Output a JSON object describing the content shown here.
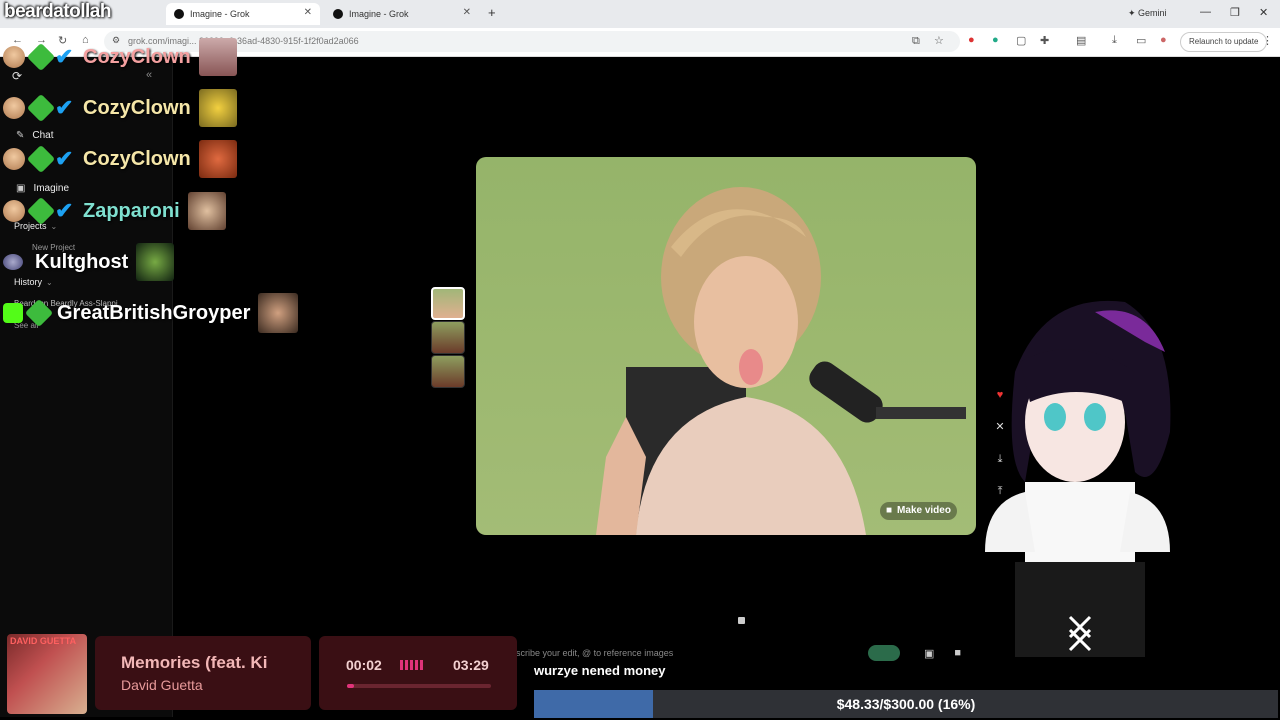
{
  "browser": {
    "tabs": [
      {
        "label": "Imagine - Grok",
        "active": true
      },
      {
        "label": "Imagine - Grok",
        "active": false
      }
    ],
    "gemini_label": "Gemini",
    "url": "grok.com/imagi... 36399e0-36ad-4830-915f-1f2f0ad2a066",
    "relaunch_label": "Relaunch to update"
  },
  "sidebar": {
    "items": [
      {
        "label": "Chat",
        "icon": "edit-icon"
      },
      {
        "label": "Imagine",
        "icon": "image-icon"
      },
      {
        "label": "Projects",
        "icon": ""
      },
      {
        "label": "History",
        "icon": ""
      }
    ],
    "new_project": "New Project",
    "history_item": "Beardson Beardly Ass-Slappi",
    "see_all": "See all"
  },
  "chat": [
    {
      "user": "CozyClown",
      "color": "#f4a0a0"
    },
    {
      "user": "CozyClown",
      "color": "#f5e6a8"
    },
    {
      "user": "CozyClown",
      "color": "#f5e6a8"
    },
    {
      "user": "Zapparoni",
      "color": "#7fe0d0"
    },
    {
      "user": "Kultghost",
      "color": "#ffffff"
    },
    {
      "user": "GreatBritishGroyper",
      "color": "#ffffff"
    }
  ],
  "overlay": {
    "streamer_name": "beardatollah"
  },
  "main": {
    "make_video_label": "Make video",
    "prompt_placeholder": "scribe your edit, @ to reference images",
    "tts_message": "wurzye nened money"
  },
  "now_playing": {
    "title": "Memories (feat. Ki",
    "artist": "David Guetta",
    "elapsed": "00:02",
    "duration": "03:29",
    "progress": 0.01,
    "art_text": "DAVID GUETTA"
  },
  "goal": {
    "text": "$48.33/$300.00 (16%)",
    "progress": 0.16
  }
}
